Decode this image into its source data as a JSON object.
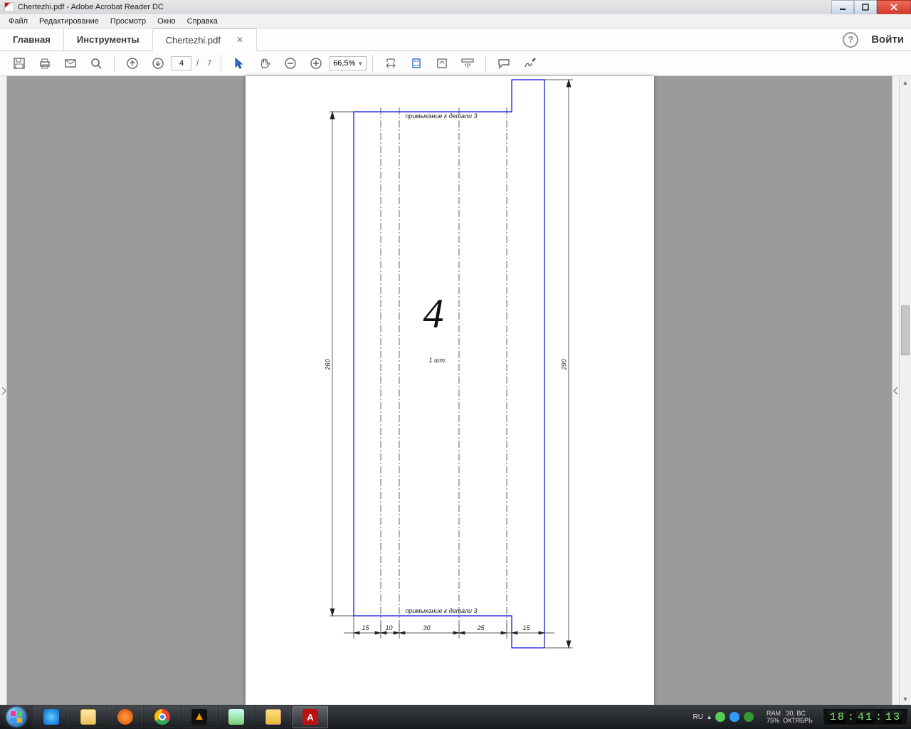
{
  "title": "Chertezhi.pdf - Adobe Acrobat Reader DC",
  "menu": {
    "file": "Файл",
    "edit": "Редактирование",
    "view": "Просмотр",
    "window": "Окно",
    "help": "Справка"
  },
  "tabs": {
    "home": "Главная",
    "tools": "Инструменты",
    "doc": "Chertezhi.pdf",
    "login": "Войти"
  },
  "toolbar": {
    "page_current": "4",
    "page_sep": "/",
    "page_total": "7",
    "zoom": "66,5%"
  },
  "drawing": {
    "part_number": "4",
    "qty": "1 шт.",
    "note_top": "примыкание к детали 3",
    "note_bottom": "примыкание к детали 3",
    "dim_left": "260",
    "dim_right": "290",
    "dim_b1": "15",
    "dim_b2": "10",
    "dim_b3": "30",
    "dim_b4": "25",
    "dim_b5": "15"
  },
  "systray": {
    "lang": "RU",
    "ram_label": "RAM",
    "ram_pct": "75%",
    "date": "30, ВС",
    "month": "ОКТЯБРЬ"
  },
  "clock": {
    "h": "18",
    "m": "41",
    "s": "13"
  }
}
